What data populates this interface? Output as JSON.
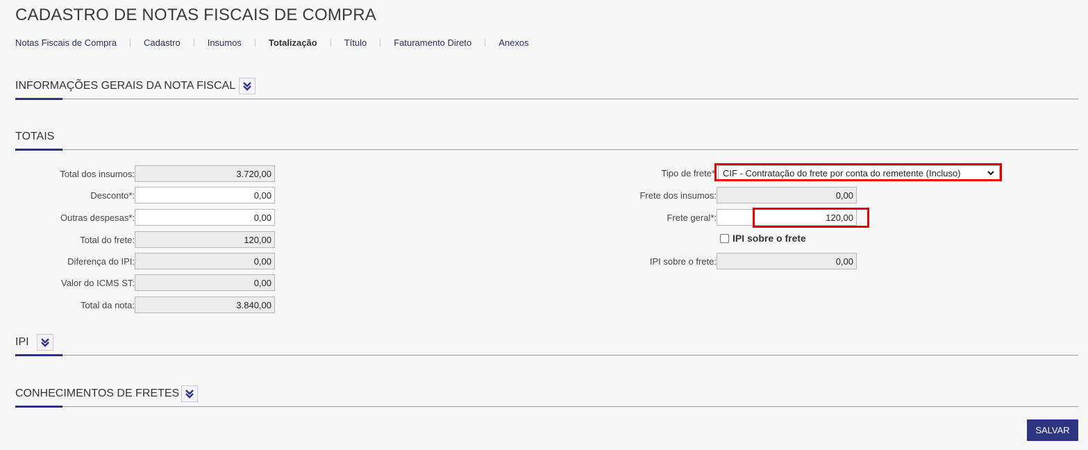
{
  "page": {
    "title": "CADASTRO DE NOTAS FISCAIS DE COMPRA"
  },
  "tabs": [
    {
      "label": "Notas Fiscais de Compra"
    },
    {
      "label": "Cadastro"
    },
    {
      "label": "Insumos"
    },
    {
      "label": "Totalização"
    },
    {
      "label": "Título"
    },
    {
      "label": "Faturamento Direto"
    },
    {
      "label": "Anexos"
    }
  ],
  "sections": {
    "info_geral": "INFORMAÇÕES GERAIS DA NOTA FISCAL",
    "totais": "TOTAIS",
    "ipi": "IPI",
    "conhecimentos": "CONHECIMENTOS DE FRETES"
  },
  "totais_left": [
    {
      "label": "Total dos insumos:",
      "value": "3.720,00"
    },
    {
      "label": "Desconto*:",
      "value": "0,00"
    },
    {
      "label": "Outras despesas*:",
      "value": "0,00"
    },
    {
      "label": "Total do frete:",
      "value": "120,00"
    },
    {
      "label": "Diferença do IPI:",
      "value": "0,00"
    },
    {
      "label": "Valor do ICMS ST:",
      "value": "0,00"
    },
    {
      "label": "Total da nota:",
      "value": "3.840,00"
    }
  ],
  "frete": {
    "tipo_label": "Tipo de frete*",
    "tipo_value": "CIF - Contratação do frete por conta do remetente (Incluso)",
    "insumos_label": "Frete dos insumos:",
    "insumos_value": "0,00",
    "geral_label": "Frete geral*:",
    "geral_value": "120,00",
    "ipi_checkbox_label": "IPI sobre o frete",
    "ipi_label": "IPI sobre o frete:",
    "ipi_value": "0,00"
  },
  "actions": {
    "save_label": "SALVAR"
  },
  "colors": {
    "accent": "#2d3580",
    "highlight": "#e60000"
  }
}
